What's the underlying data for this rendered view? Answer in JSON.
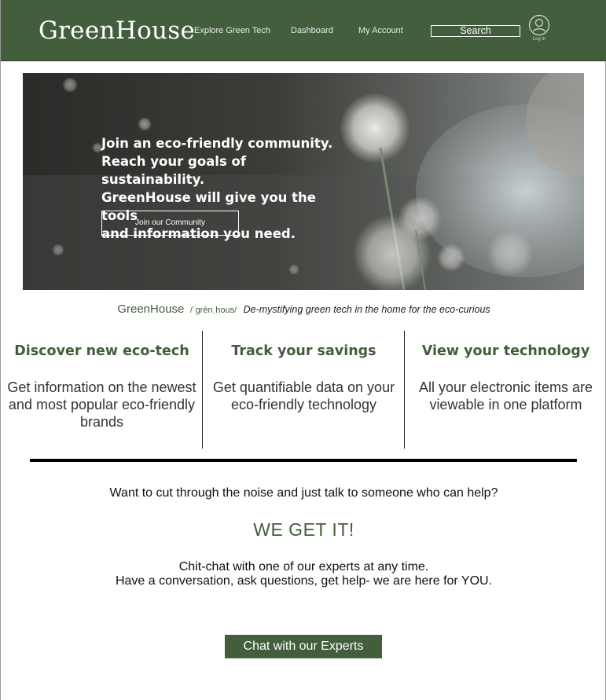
{
  "header": {
    "logo": "GreenHouse",
    "nav": [
      "Explore Green Tech",
      "Dashboard",
      "My Account"
    ],
    "search_label": "Search",
    "login_label": "Log in",
    "login_icon": "user-circle-icon"
  },
  "hero": {
    "lines": [
      "Join an eco-friendly community.",
      "Reach your goals of sustainability.",
      "GreenHouse will give you the tools",
      "and information you need."
    ],
    "button_label": "Join our Community"
  },
  "tagline": {
    "brand": "GreenHouse",
    "phonetic": "/ˈgrēnˌhous/",
    "description": "De-mystifying green tech in the home for the eco-curious"
  },
  "features": [
    {
      "title": "Discover new eco-tech",
      "body": "Get information on the newest and most popular eco-friendly brands"
    },
    {
      "title": "Track your savings",
      "body": "Get quantifiable data on your eco-friendly technology"
    },
    {
      "title": "View your technology",
      "body": "All your electronic items are viewable in one platform"
    }
  ],
  "contact": {
    "question": "Want to cut through the noise and just talk to someone who can help?",
    "headline": "WE GET IT!",
    "line1": "Chit-chat with one of our experts at any time.",
    "line2": "Have a conversation, ask questions, get help- we are here for YOU.",
    "button_label": "Chat with our Experts"
  },
  "colors": {
    "brand_green": "#435e3d",
    "white": "#ffffff"
  }
}
